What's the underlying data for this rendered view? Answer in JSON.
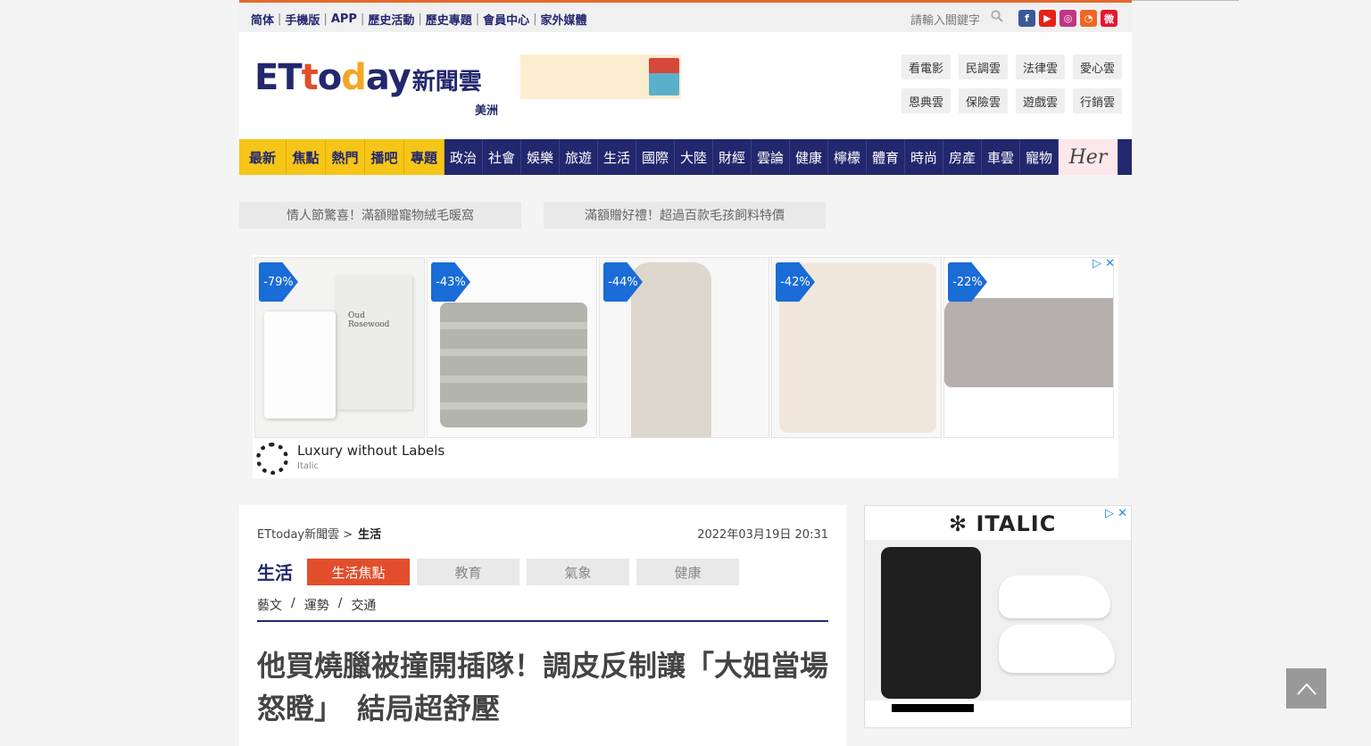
{
  "topbar": {
    "links": [
      "简体",
      "手機版",
      "APP",
      "歷史活動",
      "歷史專題",
      "會員中心",
      "家外媒體"
    ],
    "search_placeholder": "請輸入關鍵字",
    "social": [
      {
        "name": "facebook-icon",
        "glyph": "f",
        "color": "#3b5998"
      },
      {
        "name": "youtube-icon",
        "glyph": "▶",
        "color": "#e62117"
      },
      {
        "name": "instagram-icon",
        "glyph": "◎",
        "color": "#c13584"
      },
      {
        "name": "rss-icon",
        "glyph": "◔",
        "color": "#f26522"
      },
      {
        "name": "weibo-icon",
        "glyph": "微",
        "color": "#e6162d"
      }
    ]
  },
  "header": {
    "logo_brand": "ETtoday",
    "logo_cn": "新聞雲",
    "region": "美洲",
    "clouds": [
      "看電影",
      "民調雲",
      "法律雲",
      "愛心雲",
      "恩典雲",
      "保險雲",
      "遊戲雲",
      "行銷雲"
    ]
  },
  "nav": {
    "highlight": [
      "最新",
      "焦點",
      "熱門",
      "播吧",
      "專題"
    ],
    "items": [
      "政治",
      "社會",
      "娛樂",
      "旅遊",
      "生活",
      "國際",
      "大陸",
      "財經",
      "雲論",
      "健康",
      "檸檬",
      "體育",
      "時尚",
      "房產",
      "車雲",
      "寵物"
    ],
    "her": "Her"
  },
  "promos": [
    "情人節驚喜！滿額贈寵物絨毛暖窩",
    "滿額贈好禮！超過百款毛孩飼料特價"
  ],
  "ad_banner": {
    "discounts": [
      "-79%",
      "-43%",
      "-44%",
      "-42%",
      "-22%"
    ],
    "advertiser_title": "Luxury without Labels",
    "advertiser_sub": "Italic",
    "product_text": "Oud Rosewood",
    "ad_choices": "▷ ✕"
  },
  "article": {
    "breadcrumb_site": "ETtoday新聞雲 >",
    "breadcrumb_section": "生活",
    "date": "2022年03月19日 20:31",
    "category": "生活",
    "subtabs": [
      "生活焦點",
      "教育",
      "氣象",
      "健康"
    ],
    "sublinks": [
      "藝文",
      "/",
      "運勢",
      "/",
      "交通"
    ],
    "headline": "他買燒臘被撞開插隊！調皮反制讓「大姐當場怒瞪」　結局超舒壓"
  },
  "side_ad": {
    "brand": "ITALIC",
    "ad_choices": "▷ ✕"
  },
  "back_to_top": "︿"
}
